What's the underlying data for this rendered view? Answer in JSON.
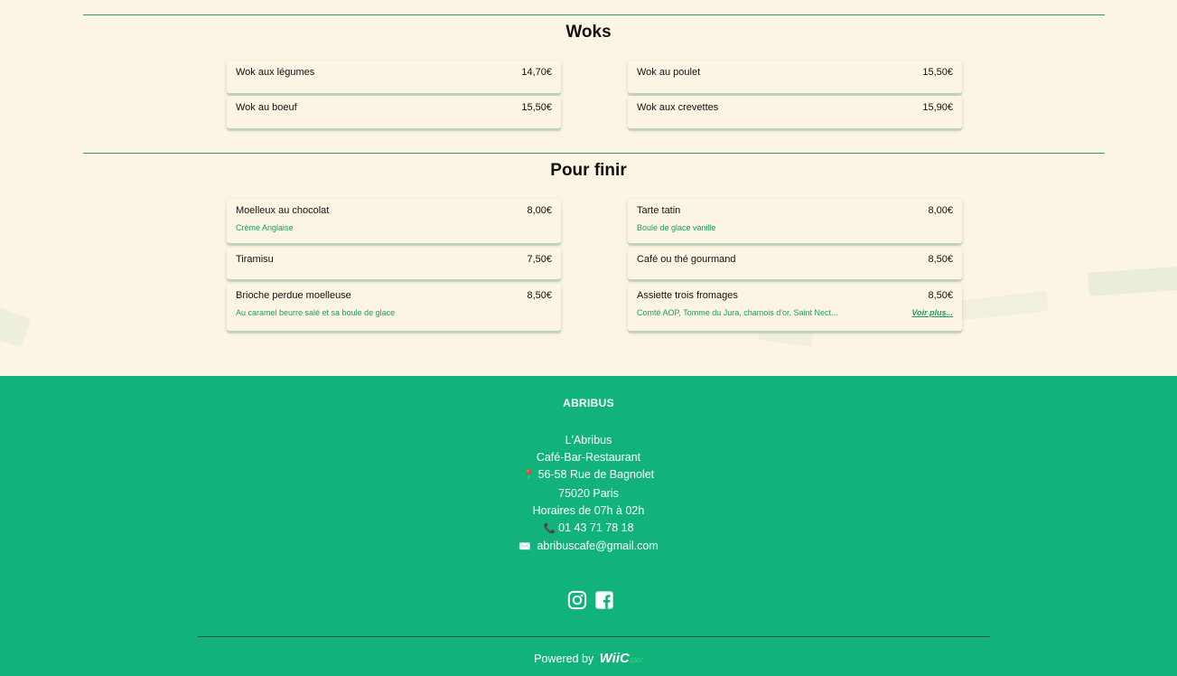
{
  "sections": [
    {
      "title": "Woks",
      "items": [
        {
          "name": "Wok aux légumes",
          "price": "14,70€"
        },
        {
          "name": "Wok au poulet",
          "price": "15,50€"
        },
        {
          "name": "Wok au boeuf",
          "price": "15,50€"
        },
        {
          "name": "Wok aux crevettes",
          "price": "15,90€"
        }
      ]
    },
    {
      "title": "Pour finir",
      "items": [
        {
          "name": "Moelleux au chocolat",
          "price": "8,00€",
          "desc": "Crème Anglaise"
        },
        {
          "name": "Tarte tatin",
          "price": "8,00€",
          "desc": "Boule de glace vanille"
        },
        {
          "name": "Tiramisu",
          "price": "7,50€"
        },
        {
          "name": "Café ou thé gourmand",
          "price": "8,50€"
        },
        {
          "name": "Brioche perdue moelleuse",
          "price": "8,50€",
          "desc": "Au caramel beurre salé et sa boule de glace"
        },
        {
          "name": "Assiette trois fromages",
          "price": "8,50€",
          "desc": "Comté AOP, Tomme du Jura, chamois d'or, Saint Nect...",
          "more": "Voir plus..."
        }
      ]
    }
  ],
  "footer": {
    "brand": "ABRIBUS",
    "name": "L'Abribus",
    "type": "Café-Bar-Restaurant",
    "address_icon": "📍",
    "address": "56-58 Rue de Bagnolet",
    "city": "75020 Paris",
    "hours": "Horaires de 07h à 02h",
    "phone_icon": "📞",
    "phone": "01 43 71 78 18",
    "email_icon": "✉️",
    "email": "abribuscafe@gmail.com",
    "socials": [
      "instagram-icon",
      "facebook-icon"
    ],
    "powered_by": "Powered by",
    "powered_logo": "WiiC",
    "powered_logo_sub": "ster"
  },
  "colors": {
    "background": "#fdf5e4",
    "footer": "#12b27b",
    "accent": "#1a9b63"
  }
}
